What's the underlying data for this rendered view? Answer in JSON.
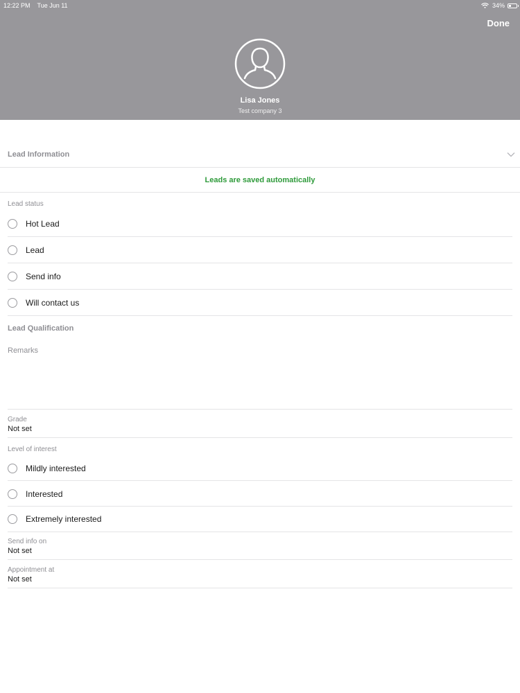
{
  "status_bar": {
    "time": "12:22 PM",
    "date": "Tue Jun 11",
    "battery": "34%",
    "battery_level": 0.34
  },
  "header": {
    "done_label": "Done",
    "contact_name": "Lisa Jones",
    "contact_company": "Test company 3",
    "background_color": "#98979b"
  },
  "lead_information": {
    "title": "Lead Information",
    "saved_notice": "Leads are saved automatically",
    "saved_notice_color": "#2e9a3a"
  },
  "lead_status": {
    "label": "Lead status",
    "options": [
      "Hot Lead",
      "Lead",
      "Send info",
      "Will contact us"
    ],
    "selected": null
  },
  "lead_qualification": {
    "title": "Lead Qualification",
    "remarks_label": "Remarks",
    "remarks_value": "",
    "grade_label": "Grade",
    "grade_value": "Not set",
    "interest_label": "Level of interest",
    "interest_options": [
      "Mildly interested",
      "Interested",
      "Extremely interested"
    ],
    "interest_selected": null,
    "send_info_label": "Send info on",
    "send_info_value": "Not set",
    "appointment_label": "Appointment at",
    "appointment_value": "Not set"
  }
}
